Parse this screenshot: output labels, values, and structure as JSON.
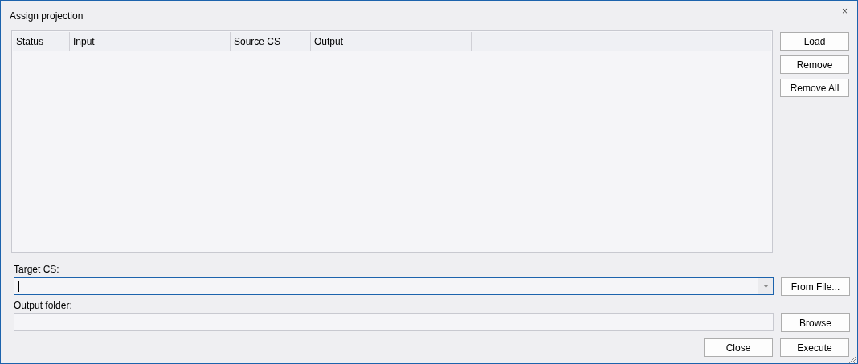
{
  "window": {
    "title": "Assign projection",
    "close": "×"
  },
  "table": {
    "columns": [
      "Status",
      "Input",
      "Source CS",
      "Output"
    ]
  },
  "side_buttons": [
    "Load",
    "Remove",
    "Remove All"
  ],
  "target_cs": {
    "label": "Target CS:",
    "focused": true,
    "button": "From File..."
  },
  "output_folder": {
    "label": "Output folder:",
    "button": "Browse"
  },
  "footer_buttons": [
    "Close",
    "Execute"
  ]
}
